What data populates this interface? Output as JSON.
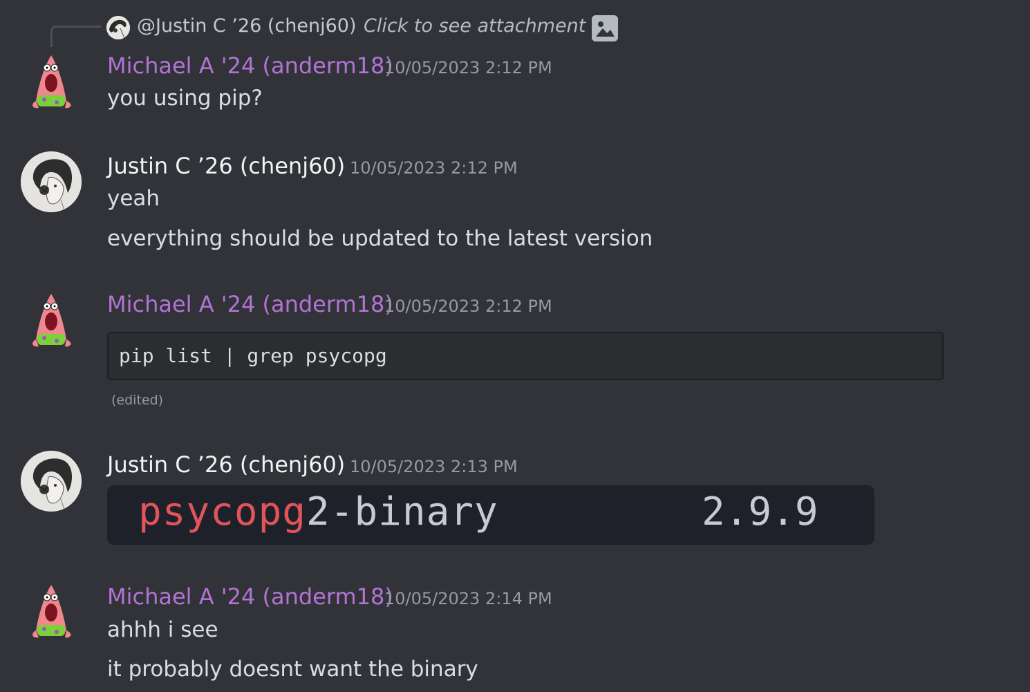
{
  "reply": {
    "name": "@Justin C ’26 (chenj60)",
    "text": "Click to see attachment"
  },
  "messages": [
    {
      "author": "Michael A '24 (anderm18)",
      "timestamp": "10/05/2023 2:12 PM",
      "lines": [
        "you using pip?"
      ]
    },
    {
      "author": "Justin C ’26 (chenj60)",
      "timestamp": "10/05/2023 2:12 PM",
      "lines": [
        "yeah",
        "everything should be updated to the latest version"
      ]
    },
    {
      "author": "Michael A '24 (anderm18)",
      "timestamp": "10/05/2023 2:12 PM",
      "code": "pip list | grep psycopg",
      "edited": "(edited)"
    },
    {
      "author": "Justin C ’26 (chenj60)",
      "timestamp": "10/05/2023 2:13 PM",
      "attachment": {
        "match": "psycopg",
        "rest": "2-binary",
        "version": "2.9.9"
      }
    },
    {
      "author": "Michael A '24 (anderm18)",
      "timestamp": "10/05/2023 2:14 PM",
      "lines": [
        "ahhh i see",
        "it probably doesnt want the binary"
      ]
    }
  ],
  "colors": {
    "background": "#313338",
    "michael_name": "#b274d4",
    "justin_name": "#f2f3f5",
    "timestamp": "#949ba4",
    "text": "#dbdee1",
    "grep_match": "#e0545a"
  }
}
